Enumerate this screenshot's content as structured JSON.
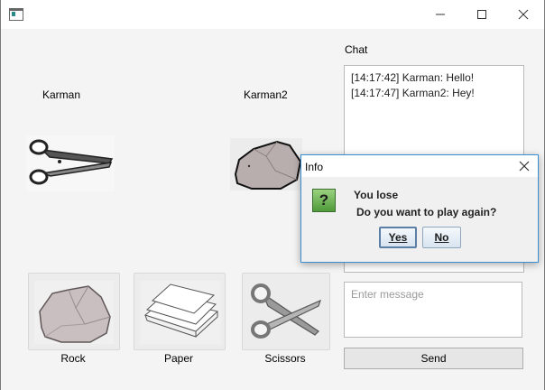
{
  "window": {
    "minimize_icon": "minimize-icon",
    "maximize_icon": "maximize-icon",
    "close_icon": "close-icon"
  },
  "players": {
    "left_name": "Karman",
    "left_hand": "scissors",
    "right_name": "Karman2",
    "right_hand": "rock"
  },
  "choices": [
    {
      "label": "Rock",
      "icon": "rock-icon"
    },
    {
      "label": "Paper",
      "icon": "paper-icon"
    },
    {
      "label": "Scissors",
      "icon": "scissors-icon"
    }
  ],
  "chat": {
    "label": "Chat",
    "messages": [
      "[14:17:42] Karman: Hello!",
      "[14:17:47] Karman2: Hey!"
    ],
    "input_placeholder": "Enter message",
    "input_value": "",
    "send_label": "Send"
  },
  "dialog": {
    "title": "Info",
    "message_line1": "You lose",
    "message_line2": "Do you want to play again?",
    "yes_label": "Yes",
    "no_label": "No",
    "icon": "question-icon"
  }
}
